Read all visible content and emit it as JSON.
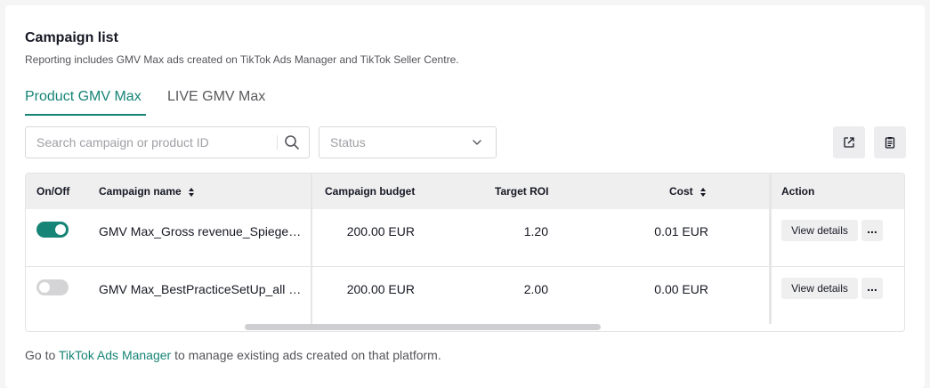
{
  "header": {
    "title": "Campaign list",
    "subtitle": "Reporting includes GMV Max ads created on TikTok Ads Manager and TikTok Seller Centre."
  },
  "tabs": [
    {
      "label": "Product GMV Max",
      "active": true
    },
    {
      "label": "LIVE GMV Max",
      "active": false
    }
  ],
  "filters": {
    "search_placeholder": "Search campaign or product ID",
    "status_placeholder": "Status"
  },
  "table": {
    "columns": {
      "onoff": "On/Off",
      "name": "Campaign name",
      "budget": "Campaign budget",
      "roi": "Target ROI",
      "cost": "Cost",
      "action": "Action"
    },
    "rows": [
      {
        "enabled": true,
        "name": "GMV Max_Gross revenue_Spiegel Ratgeber",
        "budget": "200.00 EUR",
        "roi": "1.20",
        "cost": "0.01 EUR",
        "view_label": "View details",
        "more_label": "..."
      },
      {
        "enabled": false,
        "name": "GMV Max_BestPracticeSetUp_all products",
        "budget": "200.00 EUR",
        "roi": "2.00",
        "cost": "0.00 EUR",
        "view_label": "View details",
        "more_label": "..."
      }
    ]
  },
  "footer": {
    "prefix": "Go to ",
    "link": "TikTok Ads Manager",
    "suffix": " to manage existing ads created on that platform."
  },
  "colors": {
    "accent": "#168476",
    "header_bg": "#efeff0"
  },
  "icons": {
    "search": "search-icon",
    "status_dropdown": "chevron-down-icon",
    "export": "export-icon",
    "report": "clipboard-icon",
    "sort": "sort-icon"
  }
}
